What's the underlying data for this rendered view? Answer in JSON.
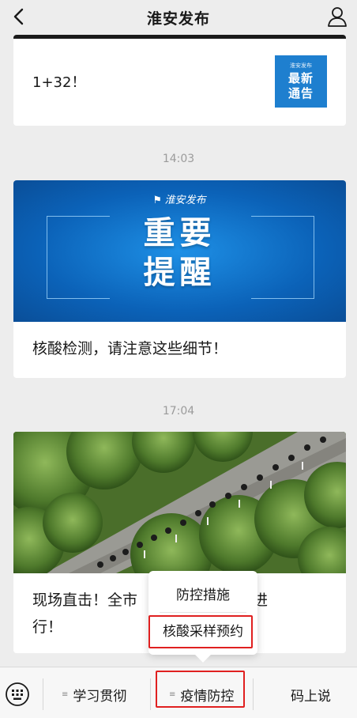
{
  "header": {
    "title": "淮安发布"
  },
  "messages": [
    {
      "text": "1+32！",
      "thumbnail": {
        "brand": "淮安发布",
        "line1": "最新",
        "line2": "通告"
      }
    },
    {
      "time": "14:03",
      "banner": {
        "brand": "淮安发布",
        "line1": "重要",
        "line2": "提醒"
      },
      "caption": "核酸检测，请注意这些细节！"
    },
    {
      "time": "17:04",
      "caption_line1": "现场直击！全市",
      "caption_line1_end": "有序进",
      "caption_line2": "行！"
    }
  ],
  "popup_menu": {
    "items": [
      "防控措施",
      "核酸采样预约"
    ]
  },
  "bottom_menu": {
    "items": [
      "学习贯彻",
      "疫情防控",
      "码上说"
    ]
  },
  "colors": {
    "highlight": "#e02020",
    "banner_blue": "#0b62b8"
  }
}
